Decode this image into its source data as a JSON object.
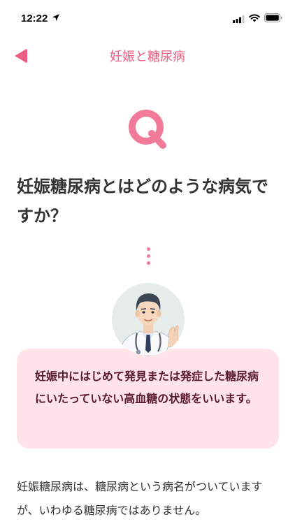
{
  "status_bar": {
    "time": "12:22",
    "icons": [
      "location-arrow-icon",
      "cellular-signal-icon",
      "wifi-icon",
      "battery-icon"
    ]
  },
  "nav": {
    "title": "妊娠と糖尿病",
    "back_icon": "back-triangle-icon"
  },
  "question": {
    "badge": "Q",
    "title": "妊娠糖尿病とはどのような病気ですか？"
  },
  "answer": {
    "text": "妊娠中にはじめて発見または発症した糖尿病にいたっていない高血糖の状態をいいます。"
  },
  "body": {
    "text": "妊娠糖尿病は、糖尿病という病名がついていますが、いわゆる糖尿病ではありません。"
  },
  "colors": {
    "accent": "#ec5f82",
    "q_badge": "#f07a98",
    "answer_bg": "#ffe3e8",
    "answer_text": "#5a1a2e",
    "body_text": "#333333"
  }
}
